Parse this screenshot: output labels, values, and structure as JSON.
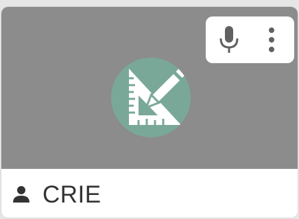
{
  "participant": {
    "name": "CRIE",
    "avatar_icon": "set-square-pencil-icon",
    "avatar_color": "#7aa898",
    "video_background": "#8c8c8c"
  },
  "controls": {
    "mic_icon": "microphone-icon",
    "more_icon": "more-vert-icon"
  },
  "name_bar": {
    "person_icon": "person-icon"
  }
}
